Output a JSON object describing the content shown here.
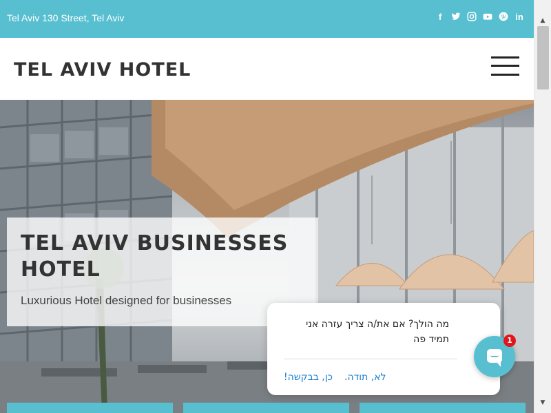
{
  "topbar": {
    "address": "Tel Aviv 130 Street, Tel Aviv",
    "background": "#58bfd0",
    "social": [
      {
        "icon": "facebook-icon",
        "glyph": "f"
      },
      {
        "icon": "twitter-icon",
        "glyph": "🐦"
      },
      {
        "icon": "instagram-icon",
        "glyph": "◎"
      },
      {
        "icon": "youtube-icon",
        "glyph": "▶"
      },
      {
        "icon": "pinterest-icon",
        "glyph": "ⓟ"
      },
      {
        "icon": "linkedin-icon",
        "glyph": "in"
      }
    ]
  },
  "header": {
    "brand": "TEL AVIV HOTEL",
    "menu_icon": "hamburger-menu-icon"
  },
  "hero": {
    "title": "TEL AVIV BUSINESSES HOTEL",
    "subtitle": "Luxurious Hotel designed for businesses"
  },
  "chat": {
    "message": "מה הולך? אם את/ה צריך עזרה אני תמיד פה",
    "yes_label": "כן, בבקשה!",
    "no_label": "לא, תודה.",
    "badge_count": "1",
    "accent": "#58bfd0",
    "badge_color": "#e0161a"
  },
  "scrollbar": {
    "up_glyph": "▲",
    "down_glyph": "▼"
  }
}
